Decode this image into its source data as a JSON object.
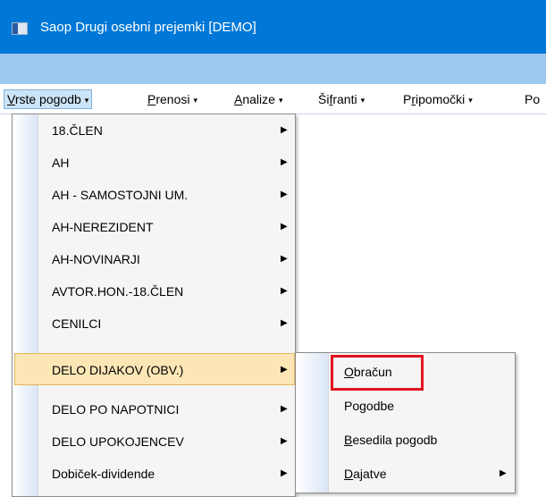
{
  "window": {
    "title": "Saop Drugi osebni prejemki [DEMO]"
  },
  "menubar": {
    "items": [
      {
        "pre": "",
        "key": "V",
        "post": "rste pogodb",
        "caret": "▾"
      },
      {
        "pre": "",
        "key": "P",
        "post": "renosi",
        "caret": "▾"
      },
      {
        "pre": "",
        "key": "A",
        "post": "nalize",
        "caret": "▾"
      },
      {
        "pre": "Ši",
        "key": "f",
        "post": "ranti",
        "caret": "▾"
      },
      {
        "pre": "P",
        "key": "r",
        "post": "ipomočki",
        "caret": "▾"
      },
      {
        "pre": "Po",
        "key": "",
        "post": "",
        "caret": ""
      }
    ]
  },
  "dropdown": {
    "items": [
      {
        "label": "18.ČLEN",
        "arrow": "▶"
      },
      {
        "label": "AH",
        "arrow": "▶"
      },
      {
        "label": "AH - SAMOSTOJNI UM.",
        "arrow": "▶"
      },
      {
        "label": "AH-NEREZIDENT",
        "arrow": "▶"
      },
      {
        "label": "AH-NOVINARJI",
        "arrow": "▶"
      },
      {
        "label": "AVTOR.HON.-18.ČLEN",
        "arrow": "▶"
      },
      {
        "label": "CENILCI",
        "arrow": "▶"
      },
      {
        "label": "DELO DIJAKOV (OBV.)",
        "arrow": "▶"
      },
      {
        "label": "DELO PO NAPOTNICI",
        "arrow": "▶"
      },
      {
        "label": "DELO UPOKOJENCEV",
        "arrow": "▶"
      },
      {
        "label": "Dobiček-dividende",
        "arrow": "▶"
      }
    ]
  },
  "submenu": {
    "items": [
      {
        "key": "O",
        "rest": "bračun",
        "arrow": ""
      },
      {
        "key": "",
        "rest": "Pogodbe",
        "arrow": ""
      },
      {
        "key": "B",
        "rest": "esedila pogodb",
        "arrow": ""
      },
      {
        "key": "D",
        "rest": "ajatve",
        "arrow": "▶"
      }
    ]
  },
  "colors": {
    "titlebar": "#0078d7",
    "highlight": "#fce6b5",
    "annotation": "#e0141e"
  }
}
